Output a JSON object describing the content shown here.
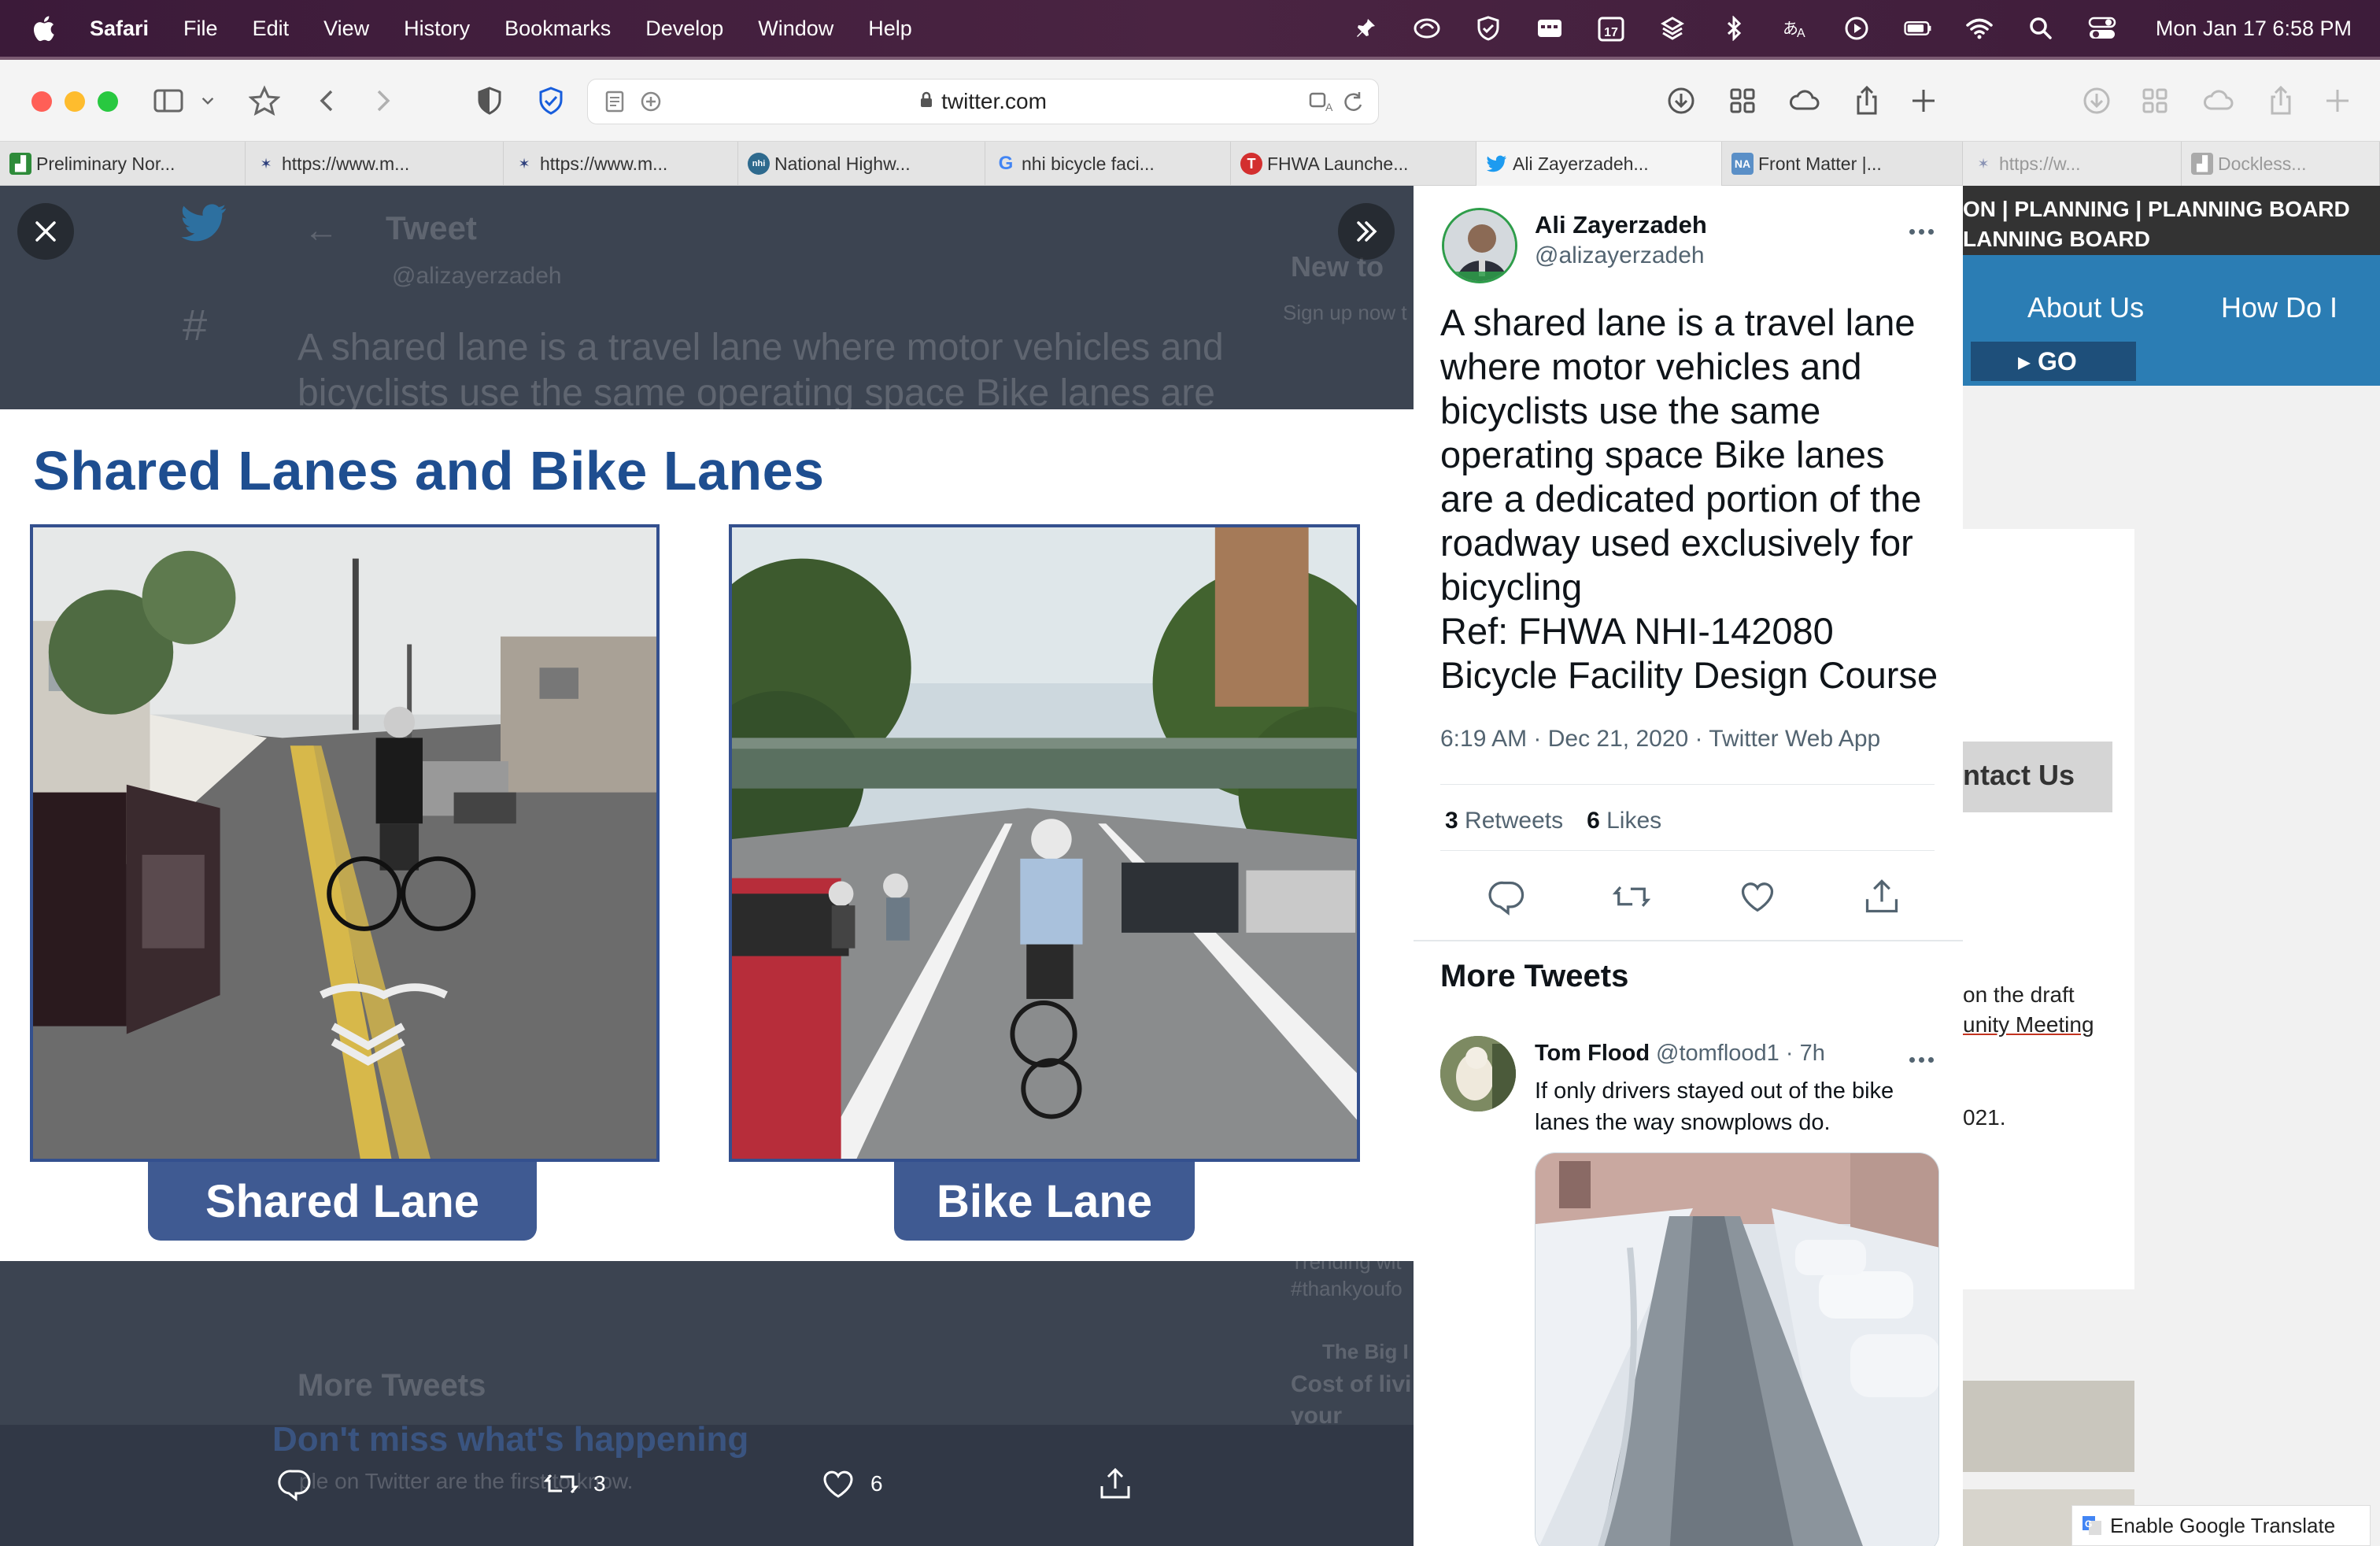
{
  "menubar": {
    "app_name": "Safari",
    "items": [
      "File",
      "Edit",
      "View",
      "History",
      "Bookmarks",
      "Develop",
      "Window",
      "Help"
    ],
    "datetime": "Mon Jan 17  6:58 PM",
    "calendar_day": "17"
  },
  "browser": {
    "url": "twitter.com",
    "tabs": [
      {
        "title": "Preliminary Nor...",
        "favicon": "chart-favicon",
        "color": "#2e8b3a"
      },
      {
        "title": "https://www.m...",
        "favicon": "star-favicon",
        "color": "#2d3f7c"
      },
      {
        "title": "https://www.m...",
        "favicon": "star-favicon",
        "color": "#2d3f7c"
      },
      {
        "title": "National Highw...",
        "favicon": "nhi-favicon",
        "color": "#2e6a8e"
      },
      {
        "title": "nhi bicycle faci...",
        "favicon": "google-favicon",
        "color": "#4285f4"
      },
      {
        "title": "FHWA Launche...",
        "favicon": "t-favicon",
        "color": "#d32f2f"
      },
      {
        "title": "Ali Zayerzadeh...",
        "favicon": "twitter-favicon",
        "color": "#1d9bf0"
      },
      {
        "title": "Front Matter |...",
        "favicon": "na-favicon",
        "color": "#5a8fc7"
      },
      {
        "title": "https://w...",
        "favicon": "star-favicon",
        "color": "#2d3f7c"
      },
      {
        "title": "Dockless...",
        "favicon": "chart-favicon",
        "color": "#888888"
      }
    ]
  },
  "background_page": {
    "topbar_line1": "ON  |  PLANNING  |  PLANNING BOARD",
    "topbar_line2": "LANNING BOARD",
    "nav_about": "About Us",
    "nav_howdoi": "How Do I",
    "go_label": "GO",
    "contact_label": "ntact Us",
    "text_line1": "on the draft",
    "text_line2": "unity Meeting",
    "text_line3": "021.",
    "translate_label": "Enable Google Translate"
  },
  "twitter_bg": {
    "header_title": "Tweet",
    "handle": "@alizayerzadeh",
    "text_line1": "A shared lane is a travel lane where motor vehicles and",
    "text_line2": "bicyclists use the same operating space Bike lanes are",
    "new_to": "New to",
    "signup": "Sign up now t",
    "trending": "Trending wit",
    "hashtag": "#thankyoufo",
    "big_label": "The Big I",
    "cost": "Cost of livi",
    "finance": "your financ",
    "more_tweets": "More Tweets",
    "dont_miss": "Don't miss what's happening",
    "people": "ple on Twitter are the first to know."
  },
  "media": {
    "slide_title": "Shared Lanes and Bike Lanes",
    "left_caption": "Shared Lane",
    "right_caption": "Bike Lane",
    "retweet_count": "3",
    "like_count": "6"
  },
  "tweet": {
    "author_name": "Ali Zayerzadeh",
    "author_handle": "@alizayerzadeh",
    "text": "A shared lane is a travel lane where motor vehicles and bicyclists use the same operating space Bike lanes are a dedicated portion of the roadway used exclusively for bicycling\nRef: FHWA NHI-142080 Bicycle Facility Design Course",
    "meta": "6:19 AM · Dec 21, 2020 · Twitter Web App",
    "retweets": "3",
    "retweets_label": "Retweets",
    "likes": "6",
    "likes_label": "Likes"
  },
  "more_tweets": {
    "title": "More Tweets",
    "reply": {
      "name": "Tom Flood",
      "handle": "@tomflood1 · 7h",
      "text": "If only drivers stayed out of the bike lanes the way snowplows do."
    }
  }
}
